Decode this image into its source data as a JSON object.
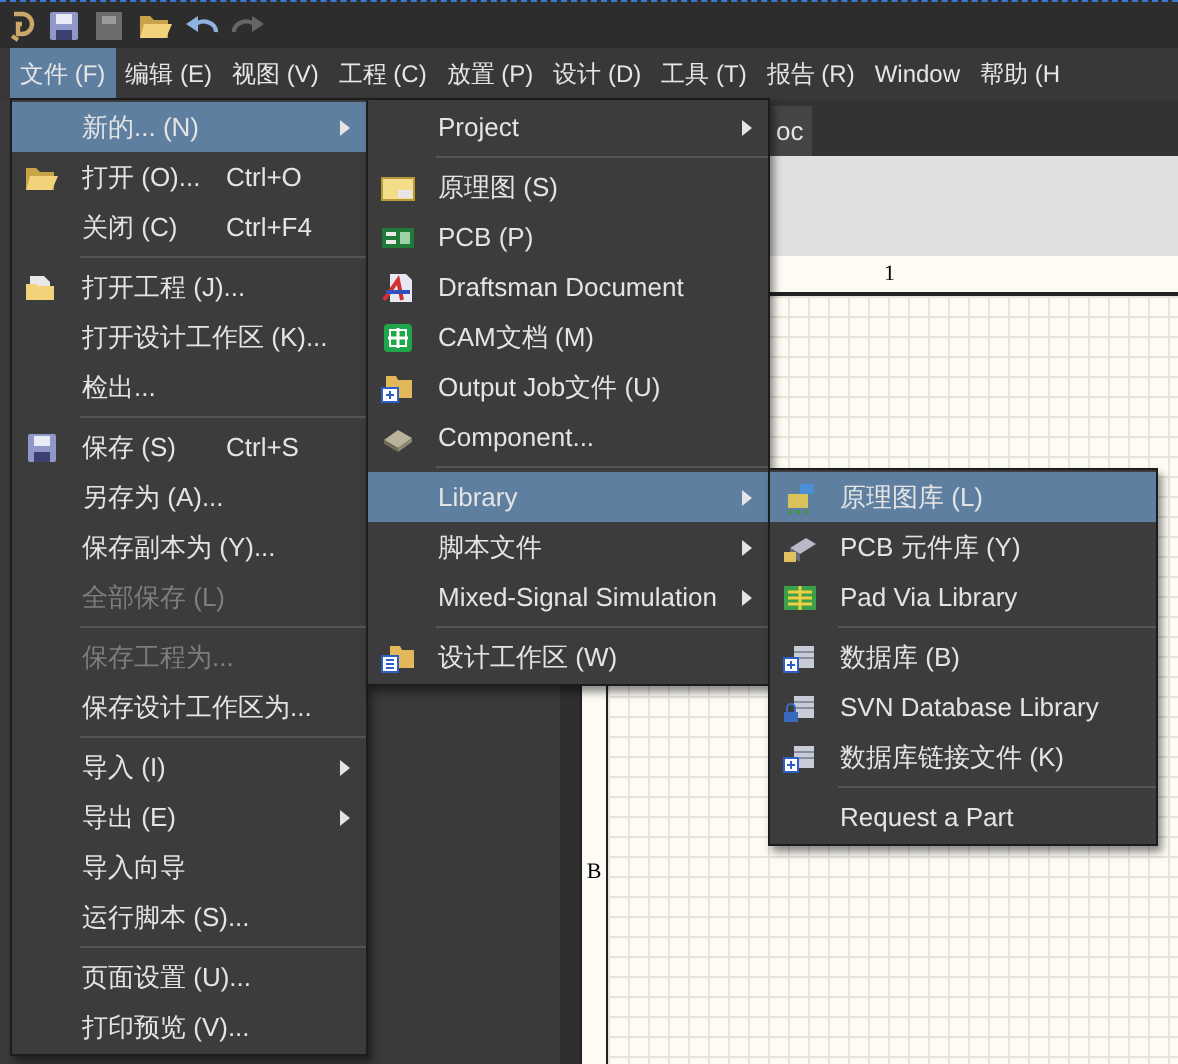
{
  "menubar": [
    {
      "label": "文件 (F)",
      "selected": true
    },
    {
      "label": "编辑 (E)",
      "selected": false
    },
    {
      "label": "视图 (V)",
      "selected": false
    },
    {
      "label": "工程 (C)",
      "selected": false
    },
    {
      "label": "放置 (P)",
      "selected": false
    },
    {
      "label": "设计 (D)",
      "selected": false
    },
    {
      "label": "工具 (T)",
      "selected": false
    },
    {
      "label": "报告 (R)",
      "selected": false
    },
    {
      "label": "Window",
      "selected": false
    },
    {
      "label": "帮助 (H",
      "selected": false
    }
  ],
  "document_tab": {
    "label": "oc"
  },
  "ruler": {
    "column_label": "1",
    "row_label": "B"
  },
  "file_menu": [
    {
      "kind": "item",
      "label": "新的... (N)",
      "submenu": true,
      "selected": true,
      "disabled": false
    },
    {
      "kind": "item",
      "label": "打开 (O)...",
      "shortcut": "Ctrl+O",
      "submenu": false,
      "selected": false,
      "disabled": false
    },
    {
      "kind": "item",
      "label": "关闭 (C)",
      "shortcut": "Ctrl+F4",
      "submenu": false,
      "selected": false,
      "disabled": false
    },
    {
      "kind": "separator"
    },
    {
      "kind": "item",
      "label": "打开工程 (J)...",
      "submenu": false,
      "selected": false,
      "disabled": false
    },
    {
      "kind": "item",
      "label": "打开设计工作区 (K)...",
      "submenu": false,
      "selected": false,
      "disabled": false
    },
    {
      "kind": "item",
      "label": "检出...",
      "submenu": false,
      "selected": false,
      "disabled": false
    },
    {
      "kind": "separator"
    },
    {
      "kind": "item",
      "label": "保存 (S)",
      "shortcut": "Ctrl+S",
      "submenu": false,
      "selected": false,
      "disabled": false
    },
    {
      "kind": "item",
      "label": "另存为 (A)...",
      "submenu": false,
      "selected": false,
      "disabled": false
    },
    {
      "kind": "item",
      "label": "保存副本为 (Y)...",
      "submenu": false,
      "selected": false,
      "disabled": false
    },
    {
      "kind": "item",
      "label": "全部保存 (L)",
      "submenu": false,
      "selected": false,
      "disabled": true
    },
    {
      "kind": "separator"
    },
    {
      "kind": "item",
      "label": "保存工程为...",
      "submenu": false,
      "selected": false,
      "disabled": true
    },
    {
      "kind": "item",
      "label": "保存设计工作区为...",
      "submenu": false,
      "selected": false,
      "disabled": false
    },
    {
      "kind": "separator"
    },
    {
      "kind": "item",
      "label": "导入 (I)",
      "submenu": true,
      "selected": false,
      "disabled": false
    },
    {
      "kind": "item",
      "label": "导出 (E)",
      "submenu": true,
      "selected": false,
      "disabled": false
    },
    {
      "kind": "item",
      "label": "导入向导",
      "submenu": false,
      "selected": false,
      "disabled": false
    },
    {
      "kind": "item",
      "label": "运行脚本 (S)...",
      "submenu": false,
      "selected": false,
      "disabled": false
    },
    {
      "kind": "separator"
    },
    {
      "kind": "item",
      "label": "页面设置 (U)...",
      "submenu": false,
      "selected": false,
      "disabled": false
    },
    {
      "kind": "item",
      "label": "打印预览 (V)...",
      "submenu": false,
      "selected": false,
      "disabled": false
    }
  ],
  "new_menu": [
    {
      "kind": "item",
      "label": "Project",
      "submenu": true,
      "selected": false,
      "disabled": false
    },
    {
      "kind": "separator"
    },
    {
      "kind": "item",
      "label": "原理图 (S)",
      "submenu": false,
      "selected": false,
      "disabled": false
    },
    {
      "kind": "item",
      "label": "PCB (P)",
      "submenu": false,
      "selected": false,
      "disabled": false
    },
    {
      "kind": "item",
      "label": "Draftsman Document",
      "submenu": false,
      "selected": false,
      "disabled": false
    },
    {
      "kind": "item",
      "label": "CAM文档 (M)",
      "submenu": false,
      "selected": false,
      "disabled": false
    },
    {
      "kind": "item",
      "label": "Output Job文件 (U)",
      "submenu": false,
      "selected": false,
      "disabled": false
    },
    {
      "kind": "item",
      "label": "Component...",
      "submenu": false,
      "selected": false,
      "disabled": false
    },
    {
      "kind": "separator"
    },
    {
      "kind": "item",
      "label": "Library",
      "submenu": true,
      "selected": true,
      "disabled": false
    },
    {
      "kind": "item",
      "label": "脚本文件",
      "submenu": true,
      "selected": false,
      "disabled": false
    },
    {
      "kind": "item",
      "label": "Mixed-Signal Simulation",
      "submenu": true,
      "selected": false,
      "disabled": false
    },
    {
      "kind": "separator"
    },
    {
      "kind": "item",
      "label": "设计工作区 (W)",
      "submenu": false,
      "selected": false,
      "disabled": false
    }
  ],
  "library_menu": [
    {
      "kind": "item",
      "label": "原理图库 (L)",
      "submenu": false,
      "selected": true,
      "disabled": false
    },
    {
      "kind": "item",
      "label": "PCB 元件库 (Y)",
      "submenu": false,
      "selected": false,
      "disabled": false
    },
    {
      "kind": "item",
      "label": "Pad Via Library",
      "submenu": false,
      "selected": false,
      "disabled": false
    },
    {
      "kind": "separator"
    },
    {
      "kind": "item",
      "label": "数据库 (B)",
      "submenu": false,
      "selected": false,
      "disabled": false
    },
    {
      "kind": "item",
      "label": "SVN Database Library",
      "submenu": false,
      "selected": false,
      "disabled": false
    },
    {
      "kind": "item",
      "label": "数据库链接文件 (K)",
      "submenu": false,
      "selected": false,
      "disabled": false
    },
    {
      "kind": "separator"
    },
    {
      "kind": "item",
      "label": "Request a Part",
      "submenu": false,
      "selected": false,
      "disabled": false
    }
  ]
}
